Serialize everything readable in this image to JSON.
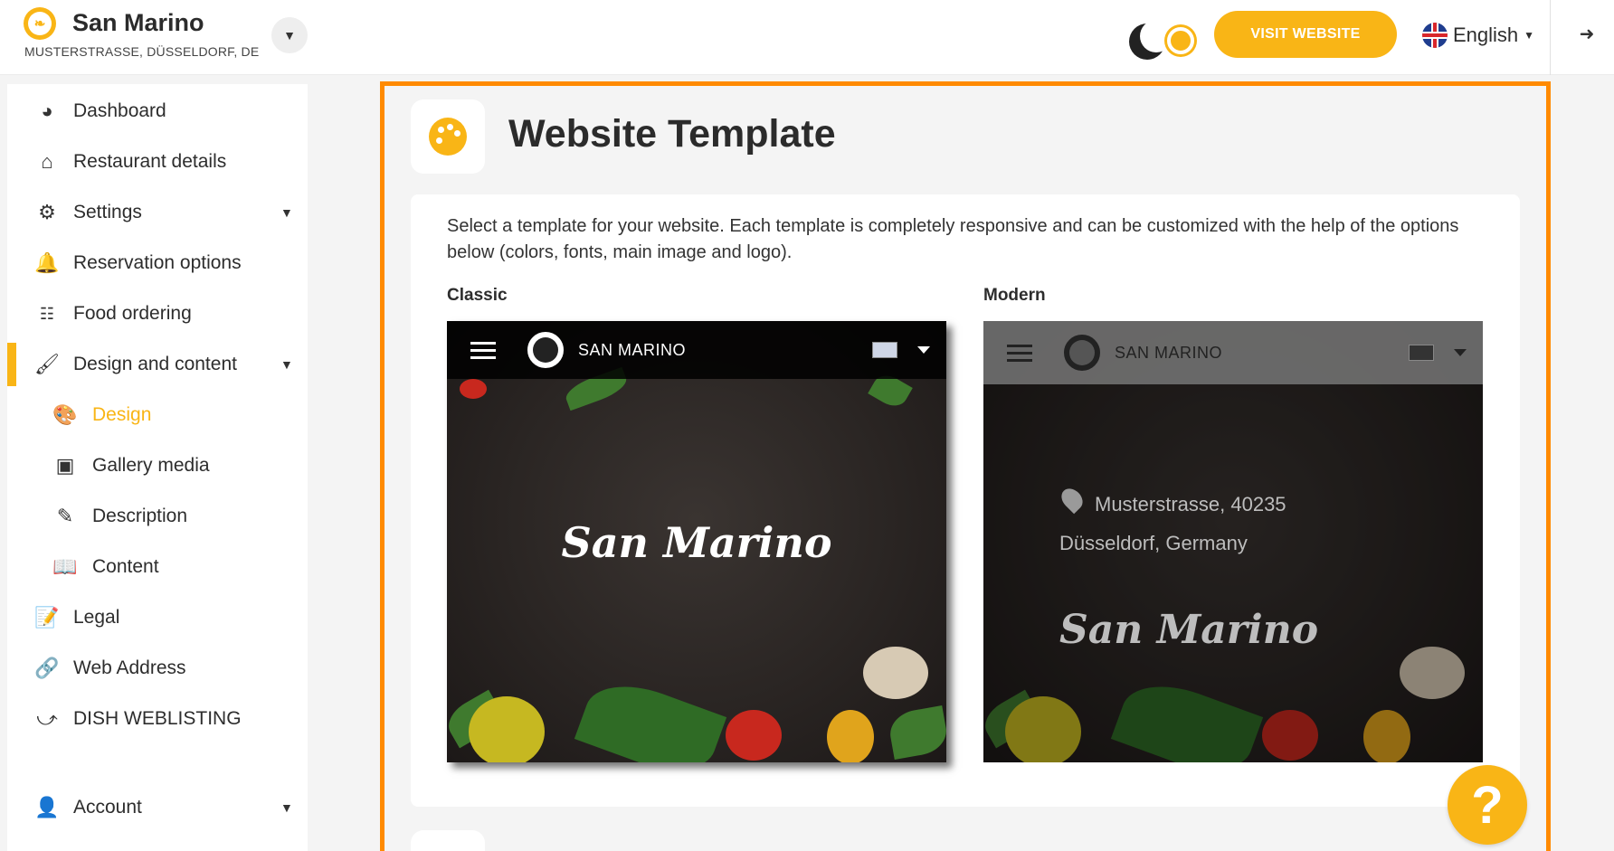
{
  "header": {
    "restaurant_name": "San Marino",
    "address": "MUSTERSTRASSE, DÜSSELDORF, DE",
    "visit_website_label": "VISIT WEBSITE",
    "language_label": "English",
    "icons": [
      "restaurant-logo-icon",
      "chevron-down-icon",
      "moon-icon",
      "sun-icon",
      "uk-flag-icon",
      "logout-icon"
    ]
  },
  "sidebar": {
    "items": [
      {
        "label": "Dashboard",
        "icon": "speedometer-icon"
      },
      {
        "label": "Restaurant details",
        "icon": "home-icon"
      },
      {
        "label": "Settings",
        "icon": "gear-icon"
      },
      {
        "label": "Reservation options",
        "icon": "bell-icon"
      },
      {
        "label": "Food ordering",
        "icon": "food-ordering-icon"
      },
      {
        "label": "Design and content",
        "icon": "brush-icon"
      },
      {
        "label": "Design",
        "icon": "palette-icon"
      },
      {
        "label": "Gallery media",
        "icon": "images-icon"
      },
      {
        "label": "Description",
        "icon": "pen-icon"
      },
      {
        "label": "Content",
        "icon": "book-icon"
      },
      {
        "label": "Legal",
        "icon": "document-edit-icon"
      },
      {
        "label": "Web Address",
        "icon": "link-icon"
      },
      {
        "label": "DISH WEBLISTING",
        "icon": "share-icon"
      },
      {
        "label": "Account",
        "icon": "user-icon"
      }
    ],
    "active_item": "Design",
    "accent_color": "#f9b516"
  },
  "main": {
    "title": "Website Template",
    "intro_text": "Select a template for your website. Each template is completely responsive and can be customized with the help of the options below (colors, fonts, main image and logo).",
    "templates": [
      {
        "label": "Classic",
        "nav_brand": "SAN MARINO",
        "hero_title": "San Marino"
      },
      {
        "label": "Modern",
        "nav_brand": "SAN MARINO",
        "address_line1": "Musterstrasse, 40235",
        "address_line2": "Düsseldorf, Germany",
        "hero_title": "San Marino"
      }
    ],
    "highlight_color": "#ff8a00"
  },
  "help_button_label": "?"
}
